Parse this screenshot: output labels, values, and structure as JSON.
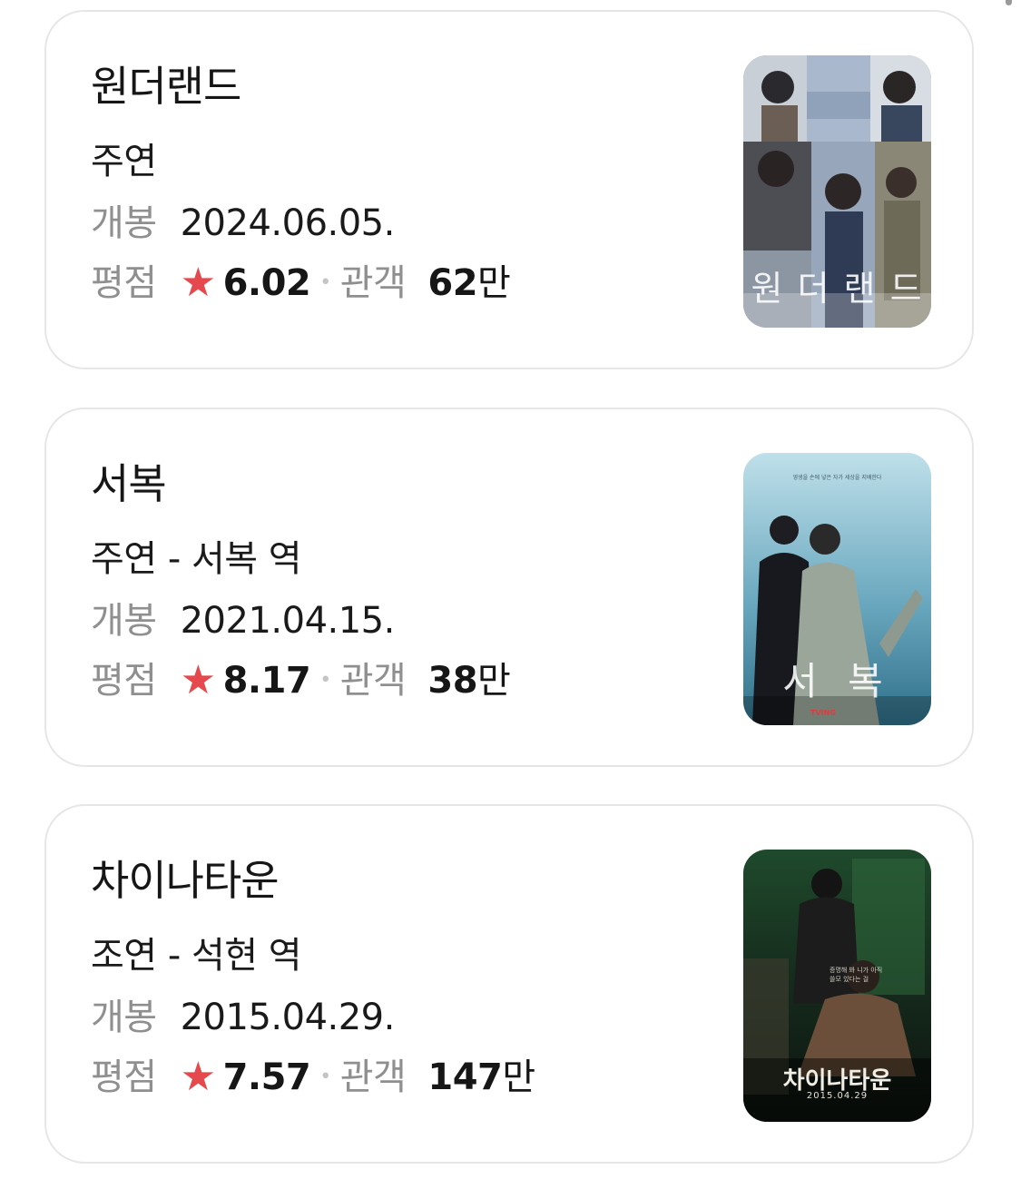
{
  "results": [
    {
      "title": "원더랜드",
      "role": "주연",
      "release_label": "개봉",
      "release_date": "2024.06.05.",
      "rating_label": "평점",
      "star_icon": "star-icon",
      "rating": "6.02",
      "separator": "•",
      "audience_label": "관객",
      "audience_number": "62",
      "audience_unit": "만",
      "poster_title": "원 더 랜 드"
    },
    {
      "title": "서복",
      "role": "주연 - 서복 역",
      "release_label": "개봉",
      "release_date": "2021.04.15.",
      "rating_label": "평점",
      "star_icon": "star-icon",
      "rating": "8.17",
      "separator": "•",
      "audience_label": "관객",
      "audience_number": "38",
      "audience_unit": "만",
      "poster_title": "서 복",
      "poster_tagline": "영생을 손에 넣은 자가 세상을 지배한다",
      "poster_brand": "TVING"
    },
    {
      "title": "차이나타운",
      "role": "조연 - 석현 역",
      "release_label": "개봉",
      "release_date": "2015.04.29.",
      "rating_label": "평점",
      "star_icon": "star-icon",
      "rating": "7.57",
      "separator": "•",
      "audience_label": "관객",
      "audience_number": "147",
      "audience_unit": "만",
      "poster_title": "차이나타운",
      "poster_date": "2015.04.29",
      "poster_tagline": "증명해 봐 니가 아직 쓸모 있다는 걸"
    }
  ],
  "colors": {
    "star": "#e5484d",
    "label_gray": "#8f8f8f",
    "card_border": "#e6e6e6",
    "text": "#161616"
  }
}
